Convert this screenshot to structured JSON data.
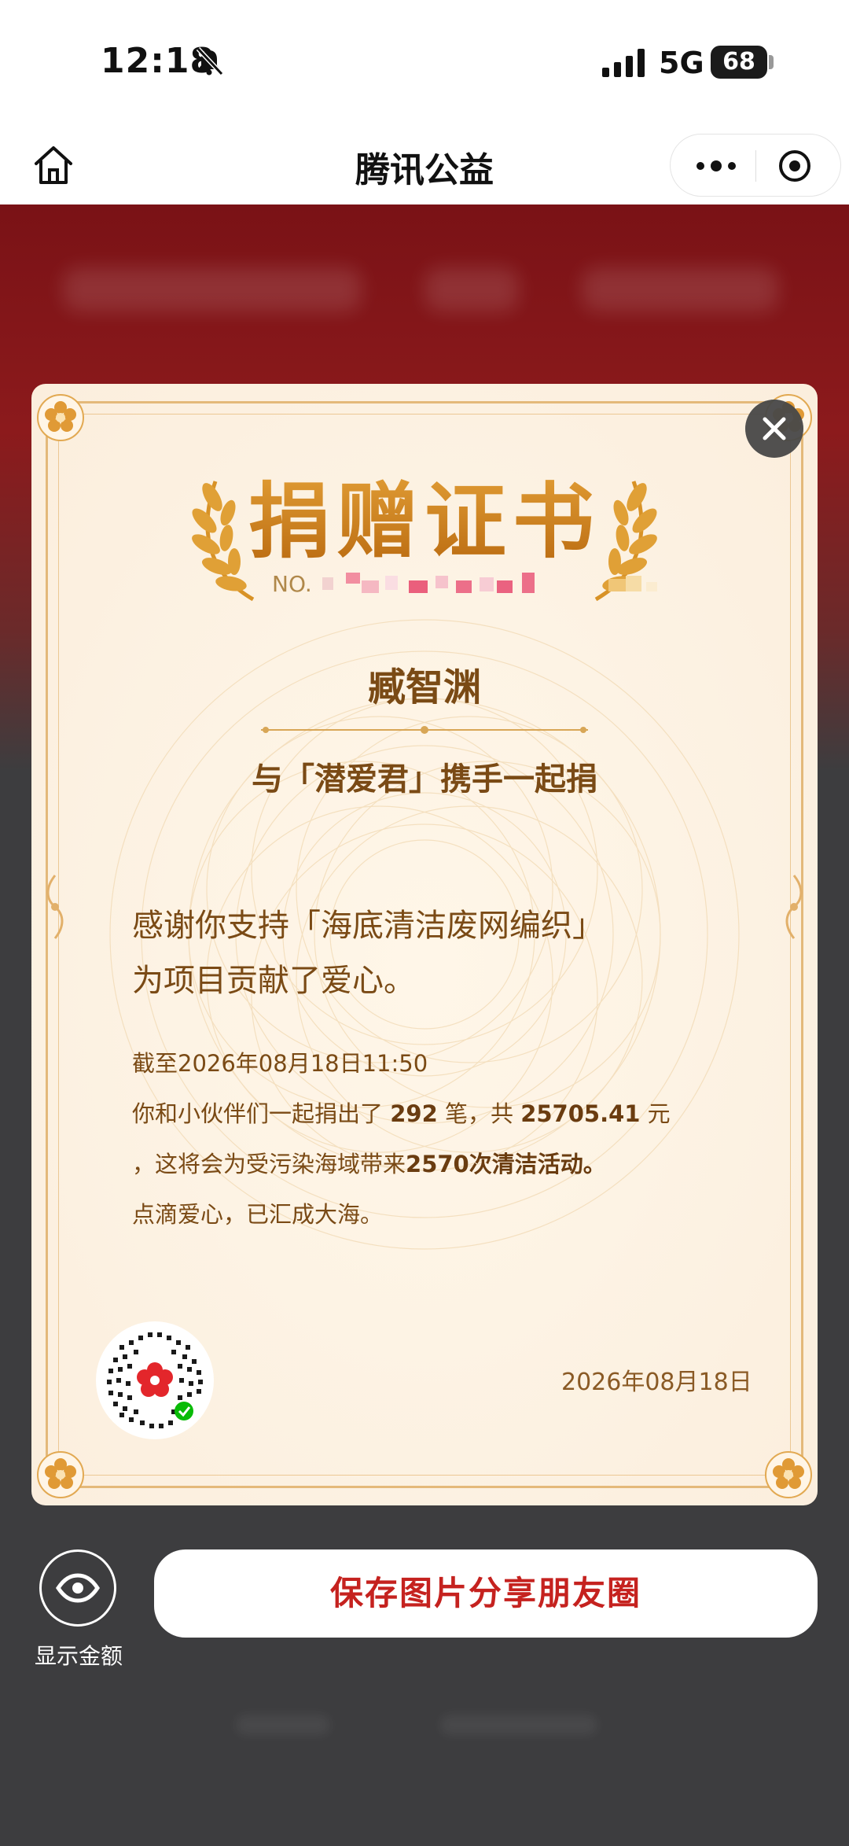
{
  "status_bar": {
    "time": "12:18",
    "network": "5G",
    "battery": "68"
  },
  "nav": {
    "title": "腾讯公益"
  },
  "certificate": {
    "title": "捐赠证书",
    "number_prefix": "NO.",
    "donor_name": "臧智渊",
    "joint_text": "与「潜爱君」携手一起捐",
    "thanks_line1": "感谢你支持「海底清洁废网编织」",
    "thanks_line2": "为项目贡献了爱心。",
    "as_of": "截至2026年08月18日11:50",
    "count_prefix": "你和小伙伴们一起捐出了 ",
    "count": "292",
    "count_mid": " 笔，共 ",
    "amount": "25705.41",
    "amount_unit": " 元",
    "impact_prefix": "，这将会为受污染海域带来",
    "impact": "2570次清洁活动。",
    "closing": "点滴爱心，已汇成大海。",
    "date": "2026年08月18日"
  },
  "actions": {
    "show_amount_label": "显示金额",
    "save_label": "保存图片分享朋友圈"
  },
  "colors": {
    "accent_red": "#c5221f",
    "gold": "#c5761a",
    "text_brown": "#7a4a15"
  }
}
